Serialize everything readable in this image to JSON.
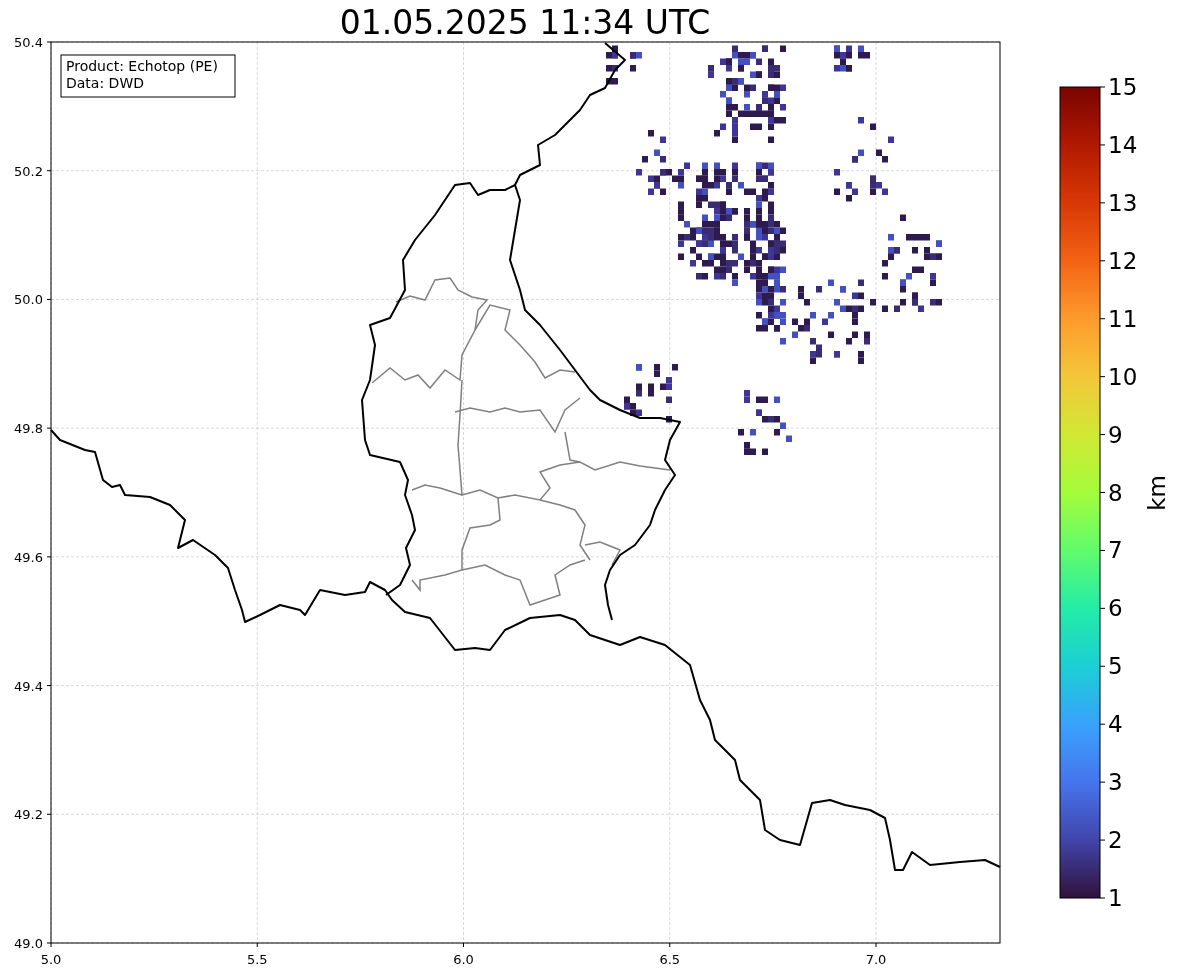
{
  "title": "01.05.2025 11:34 UTC",
  "info_box": [
    "Product: Echotop (PE)",
    "Data: DWD"
  ],
  "x_axis": {
    "ticks": [
      "5.0",
      "5.5",
      "6.0",
      "6.5",
      "7.0"
    ]
  },
  "y_axis": {
    "ticks": [
      "50.4",
      "50.2",
      "50.0",
      "49.8",
      "49.6",
      "49.4",
      "49.2",
      "49.0"
    ]
  },
  "colorbar": {
    "label": "km",
    "ticks": [
      "15",
      "14",
      "13",
      "12",
      "11",
      "10",
      "9",
      "8",
      "7",
      "6",
      "5",
      "4",
      "3",
      "2",
      "1"
    ]
  }
}
